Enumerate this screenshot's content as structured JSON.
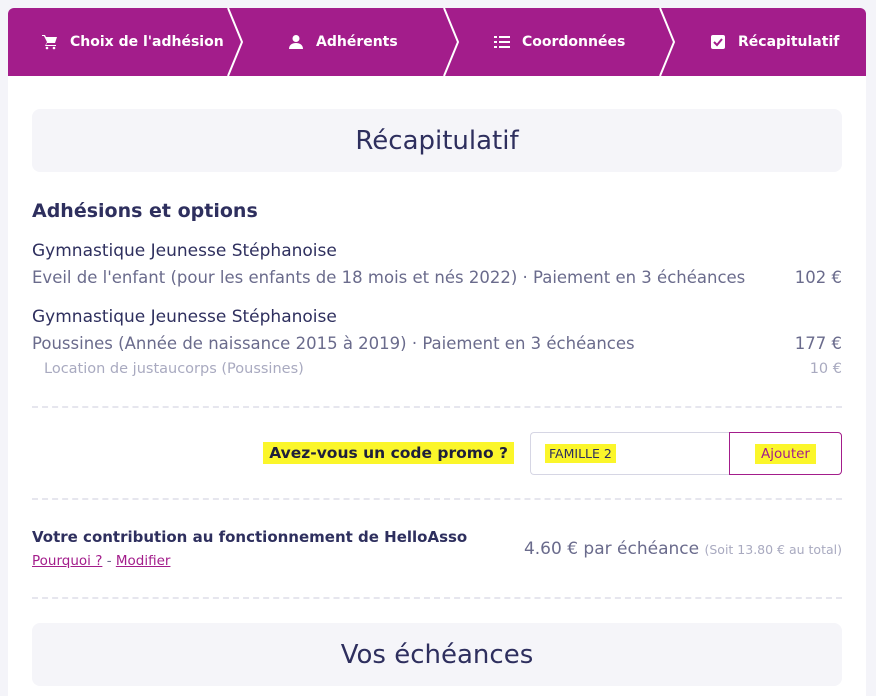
{
  "steps": [
    {
      "label": "Choix de l'adhésion",
      "icon": "cart-icon"
    },
    {
      "label": "Adhérents",
      "icon": "user-icon"
    },
    {
      "label": "Coordonnées",
      "icon": "list-icon"
    },
    {
      "label": "Récapitulatif",
      "icon": "checkbox-icon"
    }
  ],
  "recap_title": "Récapitulatif",
  "section_title": "Adhésions et options",
  "items": [
    {
      "org": "Gymnastique Jeunesse Stéphanoise",
      "desc": "Eveil de l'enfant (pour les enfants de 18 mois et nés 2022) · Paiement en 3 échéances",
      "price": "102 €"
    },
    {
      "org": "Gymnastique Jeunesse Stéphanoise",
      "desc": "Poussines (Année de naissance 2015 à 2019) · Paiement en 3 échéances",
      "price": "177 €",
      "option": {
        "label": "Location de justaucorps (Poussines)",
        "price": "10 €"
      }
    }
  ],
  "promo": {
    "label": "Avez-vous un code promo ?",
    "value": "FAMILLE 2",
    "button": "Ajouter"
  },
  "contribution": {
    "title": "Votre contribution au fonctionnement de HelloAsso",
    "why_link": "Pourquoi ?",
    "separator": "-",
    "edit_link": "Modifier",
    "amount": "4.60 € par échéance",
    "total_note": "(Soit 13.80 € au total)"
  },
  "schedule_title": "Vos échéances",
  "colors": {
    "brand": "#a31d8b",
    "highlight": "#fbf62a",
    "text": "#2e2f5e"
  }
}
